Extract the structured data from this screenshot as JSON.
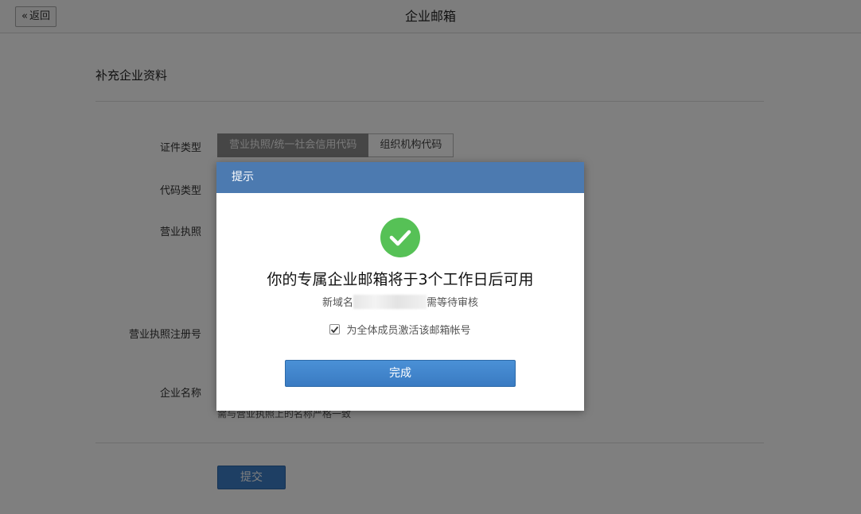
{
  "header": {
    "back_label": "返回",
    "back_icon": "double-chevron-left-icon",
    "title": "企业邮箱"
  },
  "form": {
    "section_title": "补充企业资料",
    "labels": {
      "cert_type": "证件类型",
      "code_type": "代码类型",
      "license": "营业执照",
      "license_reg_no": "营业执照注册号",
      "company_name": "企业名称"
    },
    "cert_type_options": [
      "营业执照/统一社会信用代码",
      "组织机构代码"
    ],
    "cert_type_selected": "营业执照/统一社会信用代码",
    "company_name_hint": "需与营业执照上的名称严格一致",
    "submit_label": "提交"
  },
  "modal": {
    "header": "提示",
    "icon": "check-circle-icon",
    "title": "你的专属企业邮箱将于3个工作日后可用",
    "sub_prefix": "新域名",
    "sub_suffix": "需等待审核",
    "checkbox_label": "为全体成员激活该邮箱帐号",
    "checkbox_checked": true,
    "done_label": "完成"
  },
  "colors": {
    "modal_header": "#4c7ab0",
    "success_green": "#56c156",
    "primary_button": "#3d7ec9"
  }
}
